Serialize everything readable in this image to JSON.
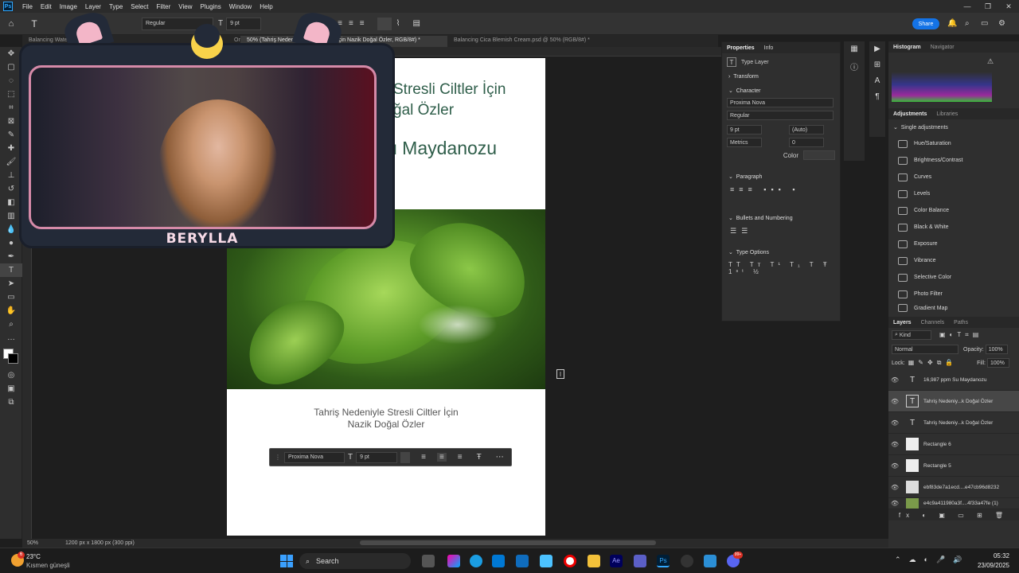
{
  "menubar": {
    "logo": "Ps",
    "items": [
      "File",
      "Edit",
      "Image",
      "Layer",
      "Type",
      "Select",
      "Filter",
      "View",
      "Plugins",
      "Window",
      "Help"
    ]
  },
  "options": {
    "font_style": "Regular",
    "font_size": "9 pt",
    "share": "Share"
  },
  "tabs": [
    {
      "label": "Balancing Water..."
    },
    {
      "label": "One-Step Water Parsley..."
    },
    {
      "label": "50% (Tahriş Nedeniyle Stresli Ciltler İçin Nazik Doğal Özler, RGB/8#) *",
      "active": true
    },
    {
      "label": "Balancing Cica Blemish Cream.psd @ 50% (RGB/8#) *"
    }
  ],
  "document": {
    "heading_line1": "Stresli Ciltler İçin",
    "heading_line2": "ğal Özler",
    "heading_big": "u Maydanozu",
    "caption_line1": "Tahriş Nedeniyle Stresli Ciltler İçin",
    "caption_line2": "Nazik Doğal Özler"
  },
  "context_bar": {
    "font": "Proxima Nova",
    "size": "9 pt"
  },
  "overlay": {
    "name": "BERYLLA"
  },
  "properties": {
    "tabs": [
      "Properties",
      "Info"
    ],
    "layer_type": "Type Layer",
    "transform": "Transform",
    "character": "Character",
    "font": "Proxima Nova",
    "style": "Regular",
    "size": "9 pt",
    "leading": "(Auto)",
    "kerning": "Metrics",
    "tracking": "0",
    "color_label": "Color",
    "paragraph": "Paragraph",
    "bullets": "Bullets and Numbering",
    "type_options": "Type Options"
  },
  "histogram": {
    "tabs": [
      "Histogram",
      "Navigator"
    ]
  },
  "adjustments": {
    "tabs": [
      "Adjustments",
      "Libraries"
    ],
    "section": "Single adjustments",
    "items": [
      "Hue/Saturation",
      "Brightness/Contrast",
      "Curves",
      "Levels",
      "Color Balance",
      "Black & White",
      "Exposure",
      "Vibrance",
      "Selective Color",
      "Photo Filter",
      "Gradient Map"
    ]
  },
  "layers": {
    "tabs": [
      "Layers",
      "Channels",
      "Paths"
    ],
    "kind": "Kind",
    "blend": "Normal",
    "opacity_label": "Opacity:",
    "opacity": "100%",
    "lock_label": "Lock:",
    "fill_label": "Fill:",
    "fill": "100%",
    "items": [
      {
        "name": "16,987 ppm Su Maydanozu",
        "kind": "T"
      },
      {
        "name": "Tahriş Nedeniy...k Doğal Özler",
        "kind": "T",
        "selected": true
      },
      {
        "name": "Tahriş Nedeniy...k Doğal Özler",
        "kind": "T"
      },
      {
        "name": "Rectangle 6",
        "kind": "R"
      },
      {
        "name": "Rectangle 5",
        "kind": "R"
      },
      {
        "name": "ebf83de7a1ecd....e47cb96d8232",
        "kind": "R"
      },
      {
        "name": "e4c9a411980a3f....4f33a47fe (1)",
        "kind": "R"
      }
    ]
  },
  "status": {
    "zoom": "50%",
    "doc_info": "1200 px x 1800 px (300 ppi)"
  },
  "taskbar": {
    "weather_temp": "23°C",
    "weather_desc": "Kısmen güneşli",
    "weather_badge": "6",
    "search": "Search",
    "time": "05:32",
    "date": "23/09/2025",
    "notif_badge": "99+"
  }
}
